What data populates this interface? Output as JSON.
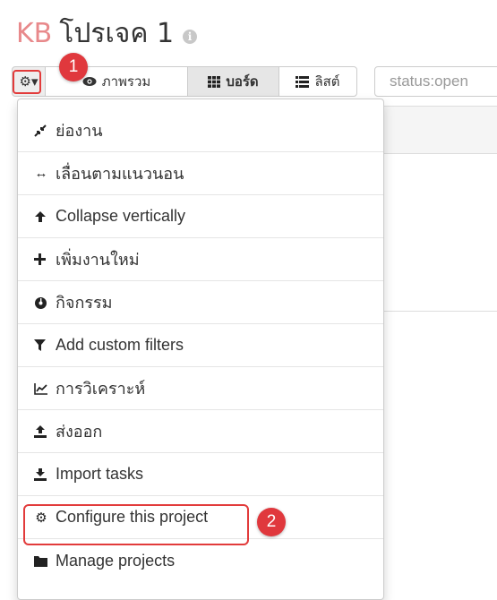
{
  "header": {
    "prefix": "KB",
    "project_name": "โปรเจค 1",
    "info_icon_glyph": "i"
  },
  "toolbar": {
    "gear_glyph": "⚙▾",
    "overview_label": "ภาพรวม",
    "board_label": "บอร์ด",
    "list_label": "ลิสต์"
  },
  "search": {
    "value": "status:open"
  },
  "menu": {
    "items": [
      {
        "label": "ย่องาน",
        "icon": "compress-icon",
        "glyph": "⤡"
      },
      {
        "label": "เลื่อนตามแนวนอน",
        "icon": "arrows-horizontal-icon",
        "glyph": "↔"
      },
      {
        "label": "Collapse vertically",
        "icon": "arrow-up-icon",
        "glyph": "🡅"
      },
      {
        "label": "เพิ่มงานใหม่",
        "icon": "plus-icon",
        "glyph": "✚"
      },
      {
        "label": "กิจกรรม",
        "icon": "dashboard-icon",
        "glyph": "◉"
      },
      {
        "label": "Add custom filters",
        "icon": "filter-icon",
        "glyph": "▼"
      },
      {
        "label": "การวิเคราะห์",
        "icon": "line-chart-icon",
        "glyph": "📈"
      },
      {
        "label": "ส่งออก",
        "icon": "upload-icon",
        "glyph": "⇪"
      },
      {
        "label": "Import tasks",
        "icon": "download-icon",
        "glyph": "⤓"
      },
      {
        "label": "Configure this project",
        "icon": "cog-icon",
        "glyph": "⚙"
      },
      {
        "label": "Manage projects",
        "icon": "folder-icon",
        "glyph": "▬"
      }
    ]
  },
  "annotations": {
    "step1": "1",
    "step2": "2",
    "highlight_color": "#e23b3b",
    "badge_color": "#e0383d"
  },
  "colors": {
    "title_prefix": "#e8898b",
    "text": "#333333",
    "border": "#cccccc"
  }
}
